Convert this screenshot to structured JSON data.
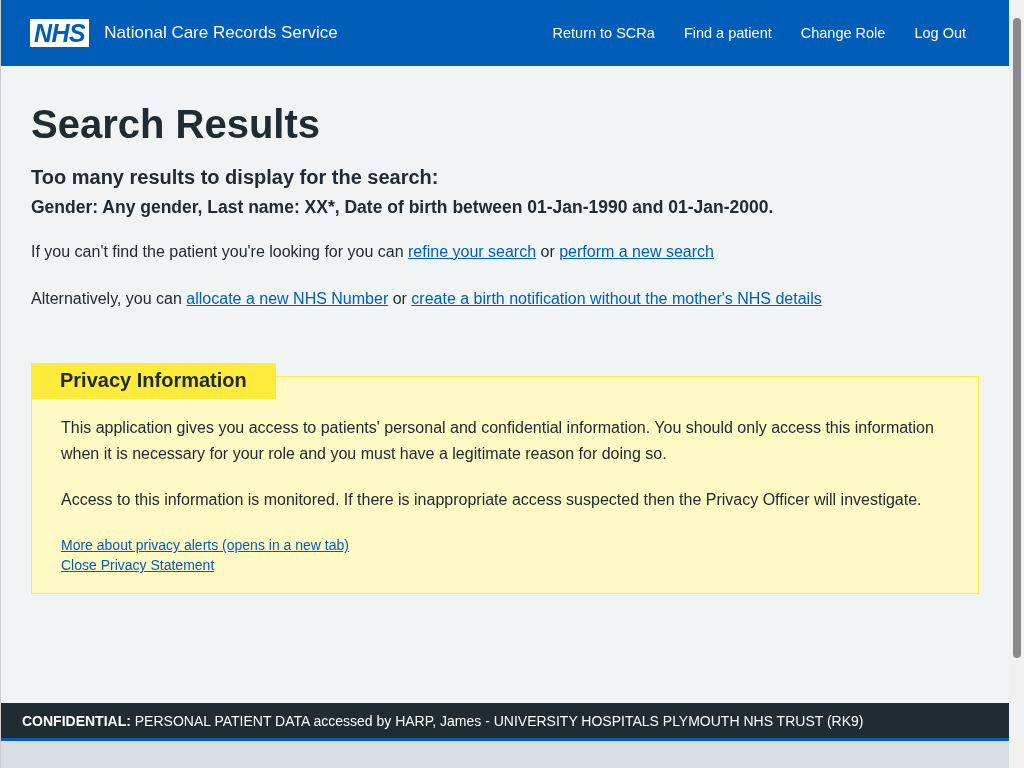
{
  "header": {
    "logo": "NHS",
    "service_name": "National Care Records Service",
    "nav": [
      "Return to SCRa",
      "Find a patient",
      "Change Role",
      "Log Out"
    ]
  },
  "title": "Search Results",
  "subtitle": "Too many results to display for the search:",
  "criteria": "Gender: Any gender, Last name: XX*, Date of birth between 01-Jan-1990 and 01-Jan-2000.",
  "paragraphs": [
    [
      {
        "kind": "text",
        "text": "If you can't find the patient you're looking for you can "
      },
      {
        "kind": "link",
        "text": "refine your search"
      },
      {
        "kind": "text",
        "text": " or "
      },
      {
        "kind": "link",
        "text": "perform a new search"
      }
    ],
    [
      {
        "kind": "text",
        "text": "Alternatively, you can "
      },
      {
        "kind": "link",
        "text": "allocate a new NHS Number"
      },
      {
        "kind": "text",
        "text": " or "
      },
      {
        "kind": "link",
        "text": "create a birth notification without the mother's NHS details"
      }
    ]
  ],
  "privacy": {
    "heading": "Privacy Information",
    "paragraphs": [
      "This application gives you access to patients' personal and confidential information. You should only access this information when it is necessary for your role and you must have a legitimate reason for doing so.",
      "Access to this information is monitored. If there is inappropriate access suspected then the Privacy Officer will investigate."
    ],
    "links": [
      "More about privacy alerts (opens in a new tab)",
      "Close Privacy Statement"
    ]
  },
  "footer": {
    "label": "CONFIDENTIAL:",
    "text": "PERSONAL PATIENT DATA accessed by HARP, James - UNIVERSITY HOSPITALS PLYMOUTH NHS TRUST (RK9)"
  }
}
